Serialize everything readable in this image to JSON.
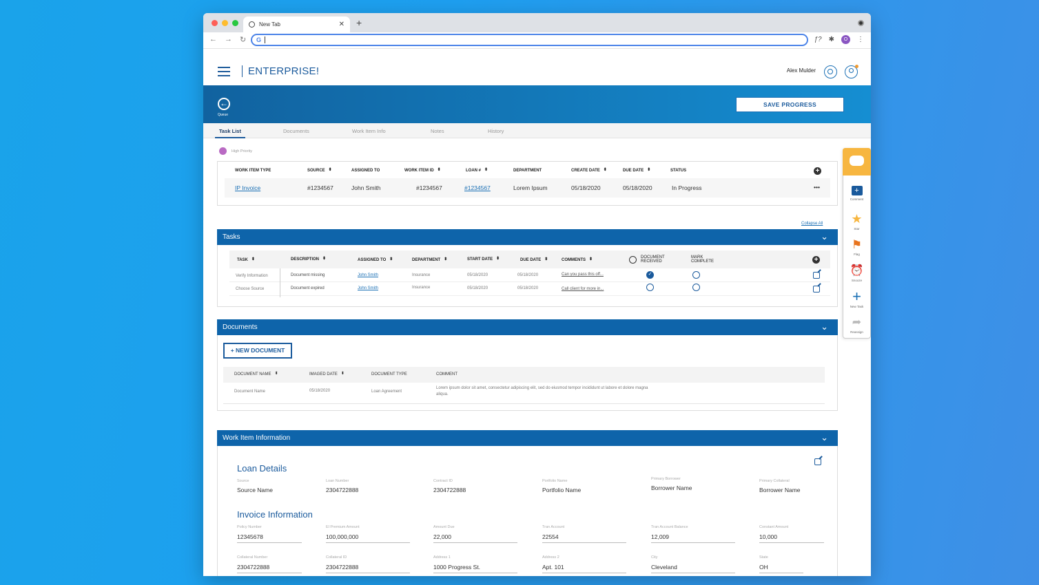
{
  "browser": {
    "tab_title": "New Tab",
    "new_tab_symbol": "+",
    "omnibox_prefix": "G"
  },
  "app": {
    "brand": "ENTERPRISE!",
    "user_name": "Alex Mulder",
    "queue_label": "Queue",
    "save_progress": "SAVE PROGRESS"
  },
  "tabs": [
    "Task List",
    "Documents",
    "Work Item Info",
    "Notes",
    "History"
  ],
  "legend": {
    "label": "High Priority",
    "color": "#b96ac3"
  },
  "work_item": {
    "headers": [
      "WORK ITEM TYPE",
      "SOURCE",
      "ASSIGNED TO",
      "WORK ITEM ID",
      "LOAN #",
      "DEPARTMENT",
      "CREATE DATE",
      "DUE DATE",
      "STATUS"
    ],
    "row": [
      "IP Invoice",
      "#1234567",
      "John Smith",
      "#1234567",
      "#1234567",
      "Lorem Ipsum",
      "05/18/2020",
      "05/18/2020",
      "In Progress"
    ],
    "more": "•••"
  },
  "collapse_all": "Collapse All",
  "tasks": {
    "title": "Tasks",
    "headers": [
      "TASK",
      "DESCRIPTION",
      "ASSIGNED TO",
      "DEPARTMENT",
      "START DATE",
      "DUE DATE",
      "COMMENTS",
      "DOCUMENT RECEIVED",
      "MARK COMPLETE"
    ],
    "rows": [
      [
        "Verify Information",
        "Document missing",
        "John Smith",
        "Insurance",
        "05/18/2020",
        "05/18/2020",
        "Can you pass this off..."
      ],
      [
        "Choose Source",
        "Document expired",
        "John Smith",
        "Insurance",
        "05/18/2020",
        "05/18/2020",
        "Call client for more in..."
      ]
    ]
  },
  "documents": {
    "title": "Documents",
    "new_button": "+ NEW DOCUMENT",
    "headers": [
      "DOCUMENT NAME",
      "IMAGED DATE",
      "DOCUMENT TYPE",
      "COMMENT"
    ],
    "row": [
      "Document Name",
      "05/18/2020",
      "Loan Agreement",
      "Lorem ipsum dolor sit amet, consectetur adipiscing elit, sed do eiusmod tempor incididunt ut labore et dolore magna",
      "aliqua."
    ]
  },
  "work_item_info": {
    "title": "Work Item Information",
    "loan_title": "Loan Details",
    "loan_fields": [
      {
        "label": "Source",
        "value": "Source Name"
      },
      {
        "label": "Loan Number",
        "value": "2304722888"
      },
      {
        "label": "Contract ID",
        "value": "2304722888"
      },
      {
        "label": "Portfolio Name",
        "value": "Portfolio Name"
      },
      {
        "label": "Primary Borrower",
        "value": "Borrower Name"
      },
      {
        "label": "Primary Collateral",
        "value": "Borrower Name"
      }
    ],
    "invoice_title": "Invoice Information",
    "invoice_row1": [
      {
        "label": "Policy Number",
        "value": "12345678"
      },
      {
        "label": "El Premium Amount",
        "value": "100,000,000"
      },
      {
        "label": "Amount Due",
        "value": "22,000"
      },
      {
        "label": "Tran Account",
        "value": "22554"
      },
      {
        "label": "Tran Account Balance",
        "value": "12,009"
      },
      {
        "label": "Constant Amount",
        "value": "10,000"
      }
    ],
    "invoice_row2": [
      {
        "label": "Collateral Number",
        "value": "2304722888"
      },
      {
        "label": "Collateral ID",
        "value": "2304722888"
      },
      {
        "label": "Address 1",
        "value": "1000 Progress St."
      },
      {
        "label": "Address 2",
        "value": "Apt. 101"
      },
      {
        "label": "City",
        "value": "Cleveland"
      },
      {
        "label": "State",
        "value": "OH"
      }
    ]
  },
  "rail": [
    "Comment",
    "Star",
    "Flag",
    "Snooze",
    "New Task",
    "Reassign"
  ],
  "colors": {
    "primary": "#0e64aa",
    "accent": "#f7b640",
    "priority": "#b96ac3"
  }
}
